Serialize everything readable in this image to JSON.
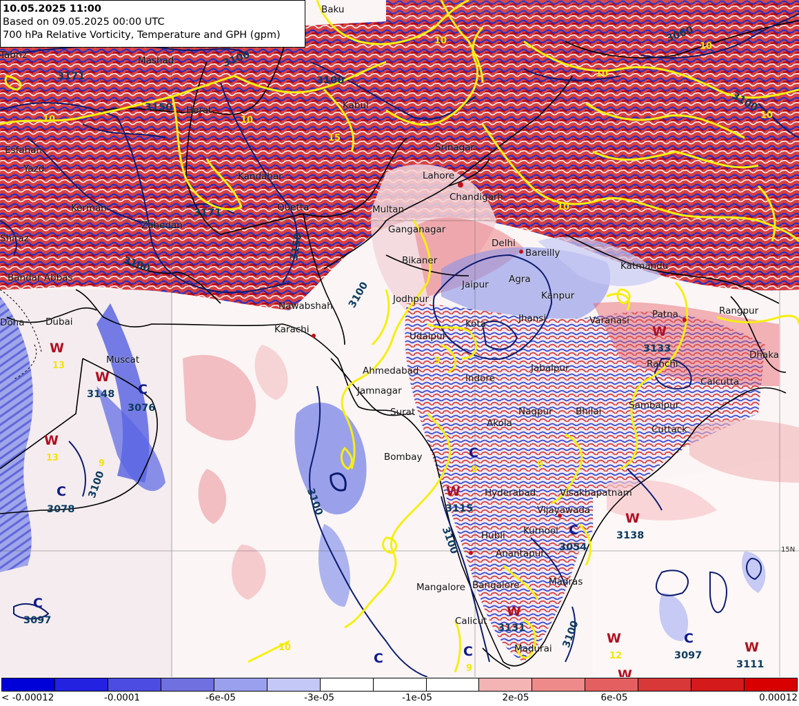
{
  "title": {
    "line1": "10.05.2025 11:00",
    "line2": "Based on 09.05.2025 00:00 UTC",
    "line3": "700 hPa Relative Vorticity, Temperature and GPH (gpm)"
  },
  "cities": [
    "Tabriz",
    "Baku",
    "Mashad",
    "Herat",
    "Kabul",
    "Srinagar",
    "Lahore",
    "Chandigarh",
    "Esfahan",
    "Yazd",
    "Kerman",
    "Zahedan",
    "Kandahar",
    "Quetta",
    "Multan",
    "Ganganagar",
    "Delhi",
    "Bareilly",
    "Bikaner",
    "Shiraz",
    "Bandar Abbas",
    "Jaipur",
    "Agra",
    "Kanpur",
    "Jodhpur",
    "Nawabshah",
    "Karachi",
    "Udaipur",
    "Kota",
    "Jhansi",
    "Varanasi",
    "Patna",
    "Rangpur",
    "Doha",
    "Dubai",
    "Muscat",
    "Ahmedabad",
    "Jamnagar",
    "Surat",
    "Indore",
    "Jabalpur",
    "Ranchi",
    "Calcutta",
    "Dhaka",
    "Nagpur",
    "Bhilai",
    "Sambalpur",
    "Cuttack",
    "Akola",
    "Bombay",
    "Hyderabad",
    "Visakhapatnam",
    "Vijayawada",
    "Hubli",
    "Kurnool",
    "Anantapur",
    "Mangalore",
    "Bangalore",
    "Madras",
    "Calicut",
    "Madurai",
    "Katmandu"
  ],
  "pressure_centers": [
    {
      "type": "W",
      "gph": "",
      "temp": "13"
    },
    {
      "type": "W",
      "gph": "3148",
      "temp": ""
    },
    {
      "type": "C",
      "gph": "3076",
      "temp": ""
    },
    {
      "type": "W",
      "gph": "",
      "temp": "13"
    },
    {
      "type": "C",
      "gph": "3078",
      "temp": ""
    },
    {
      "type": "C",
      "gph": "3097",
      "temp": ""
    },
    {
      "type": "C",
      "gph": "",
      "temp": "9"
    },
    {
      "type": "W",
      "gph": "3115",
      "temp": ""
    },
    {
      "type": "C",
      "gph": "3054",
      "temp": ""
    },
    {
      "type": "W",
      "gph": "3138",
      "temp": ""
    },
    {
      "type": "W",
      "gph": "3133",
      "temp": ""
    },
    {
      "type": "W",
      "gph": "3131",
      "temp": ""
    },
    {
      "type": "W",
      "gph": "",
      "temp": "12"
    },
    {
      "type": "C",
      "gph": "3097",
      "temp": ""
    },
    {
      "type": "W",
      "gph": "3111",
      "temp": ""
    },
    {
      "type": "C",
      "gph": "",
      "temp": "9"
    },
    {
      "type": "C",
      "gph": "",
      "temp": ""
    },
    {
      "type": "W",
      "gph": "",
      "temp": ""
    }
  ],
  "contour_labels": [
    "3171",
    "3100",
    "3100",
    "3150",
    "3100",
    "3150",
    "3171",
    "3100",
    "3100",
    "3100",
    "3100",
    "3060",
    "3100",
    "3100"
  ],
  "temp_labels": [
    "10",
    "10",
    "10",
    "10",
    "15",
    "10",
    "9",
    "9",
    "9",
    "10",
    "10",
    "10"
  ],
  "grid_labels": [
    "15N"
  ],
  "legend": {
    "colors": [
      "#0000d8",
      "#2222e0",
      "#4c4ce2",
      "#7070e0",
      "#9aa0ee",
      "#c4c8f6",
      "#ffffff",
      "#ffffff",
      "#ffffff",
      "#f4b4b4",
      "#ee8a8a",
      "#e46060",
      "#d83838",
      "#d41a1a",
      "#d80000"
    ],
    "ticks": [
      "< -0.00012",
      "-0.0001",
      "-6e-05",
      "-3e-05",
      "-1e-05",
      "2e-05",
      "6e-05",
      "0.00012"
    ]
  },
  "colors": {
    "contour": "#0a1a6e",
    "temperature": "#f5ef10",
    "border": "#000000",
    "warm_label": "#b01020",
    "cold_label": "#101a8a"
  }
}
